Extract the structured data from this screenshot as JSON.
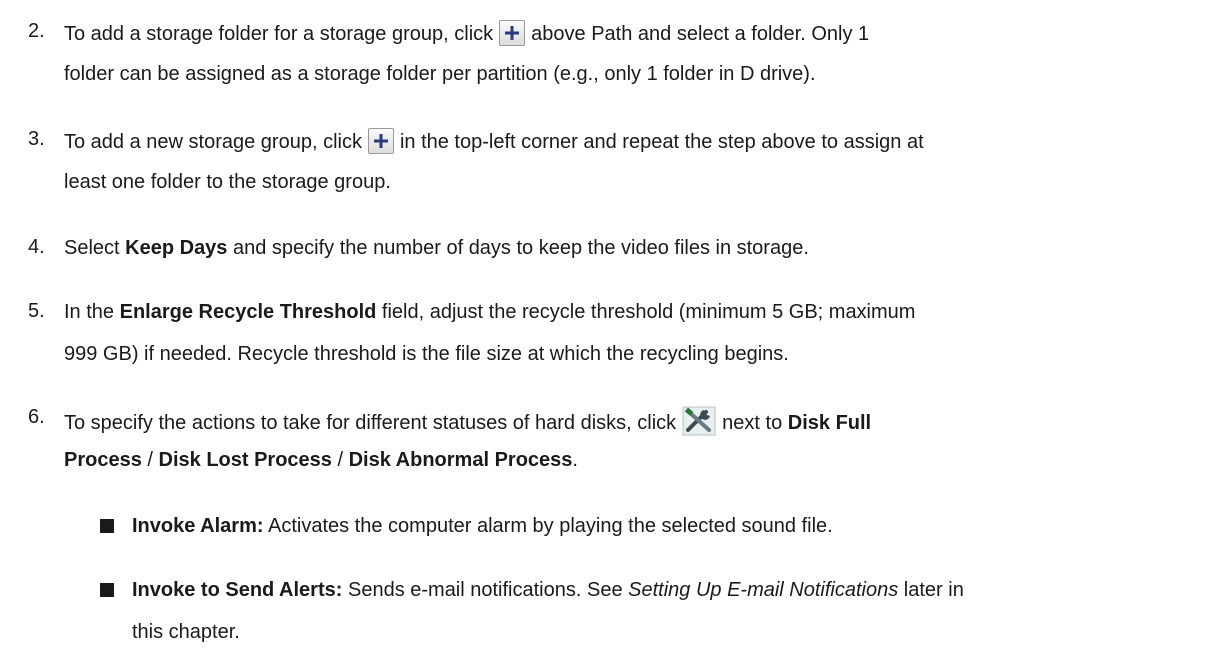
{
  "steps": [
    {
      "number": "2.",
      "line1_a": "To add a storage folder for a storage group, click",
      "line1_b": "above Path and select a folder. Only 1",
      "line2": "folder can be assigned as a storage folder per partition (e.g., only 1 folder in D drive).",
      "icon": "plus-icon"
    },
    {
      "number": "3.",
      "line1_a": "To add a new storage group, click",
      "line1_b": "in the top-left corner and repeat the step above to assign at",
      "line2": "least one folder to the storage group.",
      "icon": "plus-icon"
    },
    {
      "number": "4.",
      "line1_a": "Select ",
      "bold": "Keep Days",
      "line1_b": " and specify the number of days to keep the video files in storage."
    },
    {
      "number": "5.",
      "line1_a": "In the ",
      "bold": "Enlarge Recycle Threshold",
      "line1_b": " field, adjust the recycle threshold (minimum 5 GB; maximum",
      "line2": "999 GB) if needed. Recycle threshold is the file size at which the recycling begins."
    },
    {
      "number": "6.",
      "line1_a": "To specify the actions to take for different statuses of hard disks, click",
      "line1_b": "next to ",
      "bold1": "Disk Full",
      "line2_bold_a": "Process",
      "sep1": " / ",
      "line2_bold_b": "Disk Lost Process",
      "sep2": " / ",
      "line2_bold_c": "Disk Abnormal Process",
      "line2_end": ".",
      "icon": "tools-icon"
    }
  ],
  "bullets": [
    {
      "bold": "Invoke Alarm:",
      "text": " Activates the computer alarm by playing the selected sound file."
    },
    {
      "bold": "Invoke to Send Alerts:",
      "text_a": " Sends e-mail notifications. See ",
      "italic": "Setting Up E-mail Notifications",
      "text_b": " later in",
      "line2": "this chapter."
    }
  ]
}
